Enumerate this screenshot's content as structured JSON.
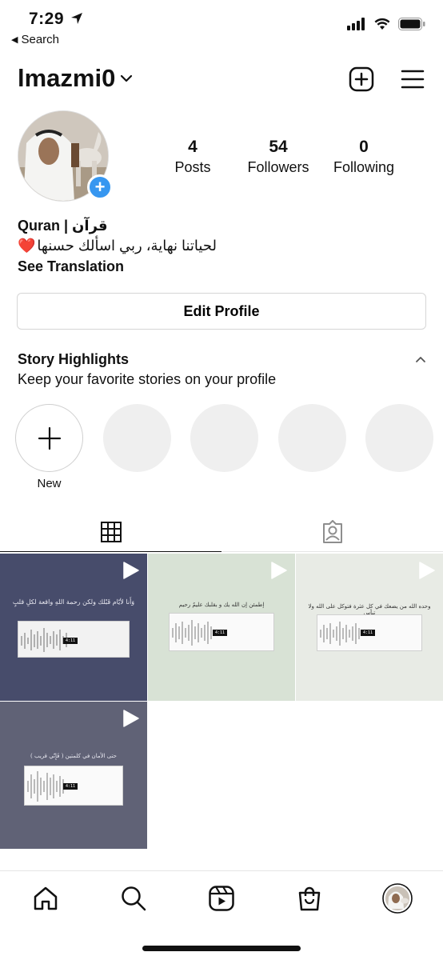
{
  "status_bar": {
    "time": "7:29",
    "back_label": "Search"
  },
  "header": {
    "username": "lmazmi0"
  },
  "profile": {
    "stats": [
      {
        "value": "4",
        "label": "Posts"
      },
      {
        "value": "54",
        "label": "Followers"
      },
      {
        "value": "0",
        "label": "Following"
      }
    ],
    "bio_name": "Quran | قرآن",
    "bio_text": "لحياتنا نهاية، ربي اسألك حسنها",
    "see_translation": "See Translation",
    "edit_profile": "Edit Profile"
  },
  "highlights": {
    "title": "Story Highlights",
    "subtitle": "Keep your favorite stories on your profile",
    "new_label": "New"
  },
  "posts": [
    {
      "caption": "وَأَنا لأيّام قَبْلك ولكن رحمة اللهِ واقعة لكلِ قلبٍ",
      "bg": "#474c6b",
      "time_label": "4:11"
    },
    {
      "caption": "إطمئن إن الله يك و بقلبك عليمٌ رحيم",
      "bg": "#d8e2d5",
      "time_label": "4:11"
    },
    {
      "caption": "وحده الله من يضعك في كل عثرة فتوكل على الله ولا تيأس",
      "bg": "#e8ebe5",
      "time_label": "4:11"
    },
    {
      "caption": "( فَإِنّي قريب ) حتى الأمان في كلمتين",
      "bg": "#606276",
      "time_label": "4:11"
    }
  ],
  "colors": {
    "accent": "#3797f0",
    "heart": "#e0245e",
    "divider": "#e5e5e5"
  },
  "icons": [
    "location-arrow-icon",
    "signal-icon",
    "wifi-icon",
    "battery-icon",
    "chevron-down-icon",
    "add-post-icon",
    "menu-icon",
    "grid-icon",
    "tagged-icon",
    "play-icon",
    "home-icon",
    "search-icon",
    "reels-icon",
    "shop-icon"
  ]
}
